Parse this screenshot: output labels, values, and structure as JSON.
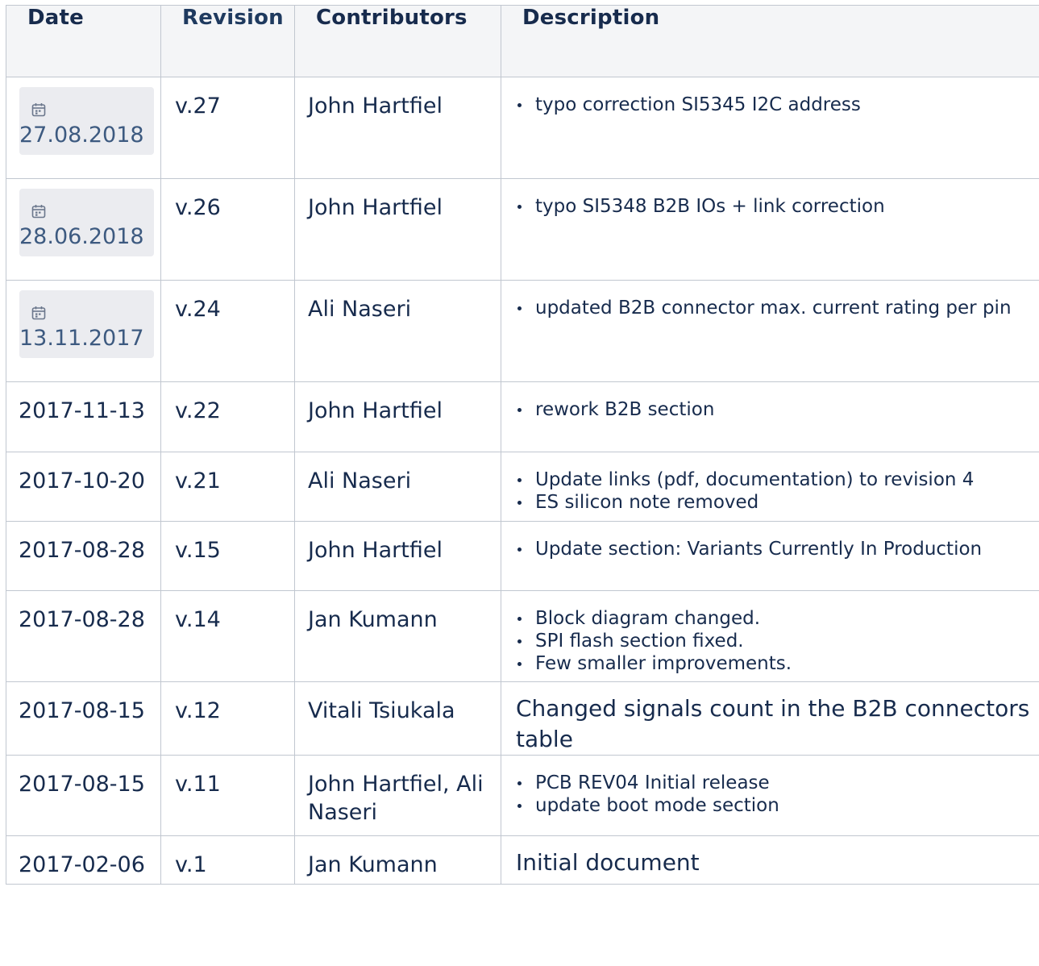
{
  "headers": {
    "date": "Date",
    "revision": "Revision",
    "contributors": "Contributors",
    "description": "Description"
  },
  "rows": [
    {
      "date": "27.08.2018",
      "date_style": "lozenge",
      "revision": "v.27",
      "contributors": "John Hartfiel",
      "description_items": [
        "typo correction SI5345 I2C address"
      ]
    },
    {
      "date": "28.06.2018",
      "date_style": "lozenge",
      "revision": "v.26",
      "contributors": "John Hartfiel",
      "description_items": [
        "typo SI5348 B2B IOs + link correction"
      ]
    },
    {
      "date": "13.11.2017",
      "date_style": "lozenge",
      "revision": "v.24",
      "contributors": "Ali Naseri",
      "description_items": [
        "updated B2B connector max. current rating per pin"
      ]
    },
    {
      "date": "2017-11-13",
      "date_style": "plain",
      "revision": "v.22",
      "contributors": "John Hartfiel",
      "description_items": [
        "rework B2B section"
      ]
    },
    {
      "date": "2017-10-20",
      "date_style": "plain",
      "revision": "v.21",
      "contributors": "Ali Naseri",
      "description_items": [
        "Update links (pdf, documentation) to revision 4",
        "ES silicon note removed"
      ]
    },
    {
      "date": "2017-08-28",
      "date_style": "plain",
      "revision": "v.15",
      "contributors": "John Hartfiel",
      "description_items": [
        "Update section: Variants Currently In Production"
      ]
    },
    {
      "date": "2017-08-28",
      "date_style": "plain",
      "revision": "v.14",
      "contributors": "Jan Kumann",
      "description_items": [
        "Block diagram changed.",
        "SPI flash section fixed.",
        "Few smaller improvements."
      ]
    },
    {
      "date": "2017-08-15",
      "date_style": "plain",
      "revision": "v.12",
      "contributors": "Vitali Tsiukala",
      "description_text": "Changed signals count in the B2B connectors table"
    },
    {
      "date": "2017-08-15",
      "date_style": "plain",
      "revision": "v.11",
      "contributors": "John Hartfiel, Ali Naseri",
      "description_items": [
        "PCB REV04 Initial release",
        "update boot mode section"
      ]
    },
    {
      "date": "2017-02-06",
      "date_style": "plain",
      "revision": "v.1",
      "contributors": "Jan Kumann",
      "description_text": "Initial document"
    }
  ],
  "icons": {
    "date_lozenge": "calendar-icon"
  },
  "colors": {
    "border": "#c1c7d0",
    "header_bg": "#f4f5f7",
    "text": "#172b4d",
    "revision_header": "#1f3a5f",
    "date_lozenge_bg": "#ebecf0",
    "date_lozenge_text": "#3d5a80"
  }
}
